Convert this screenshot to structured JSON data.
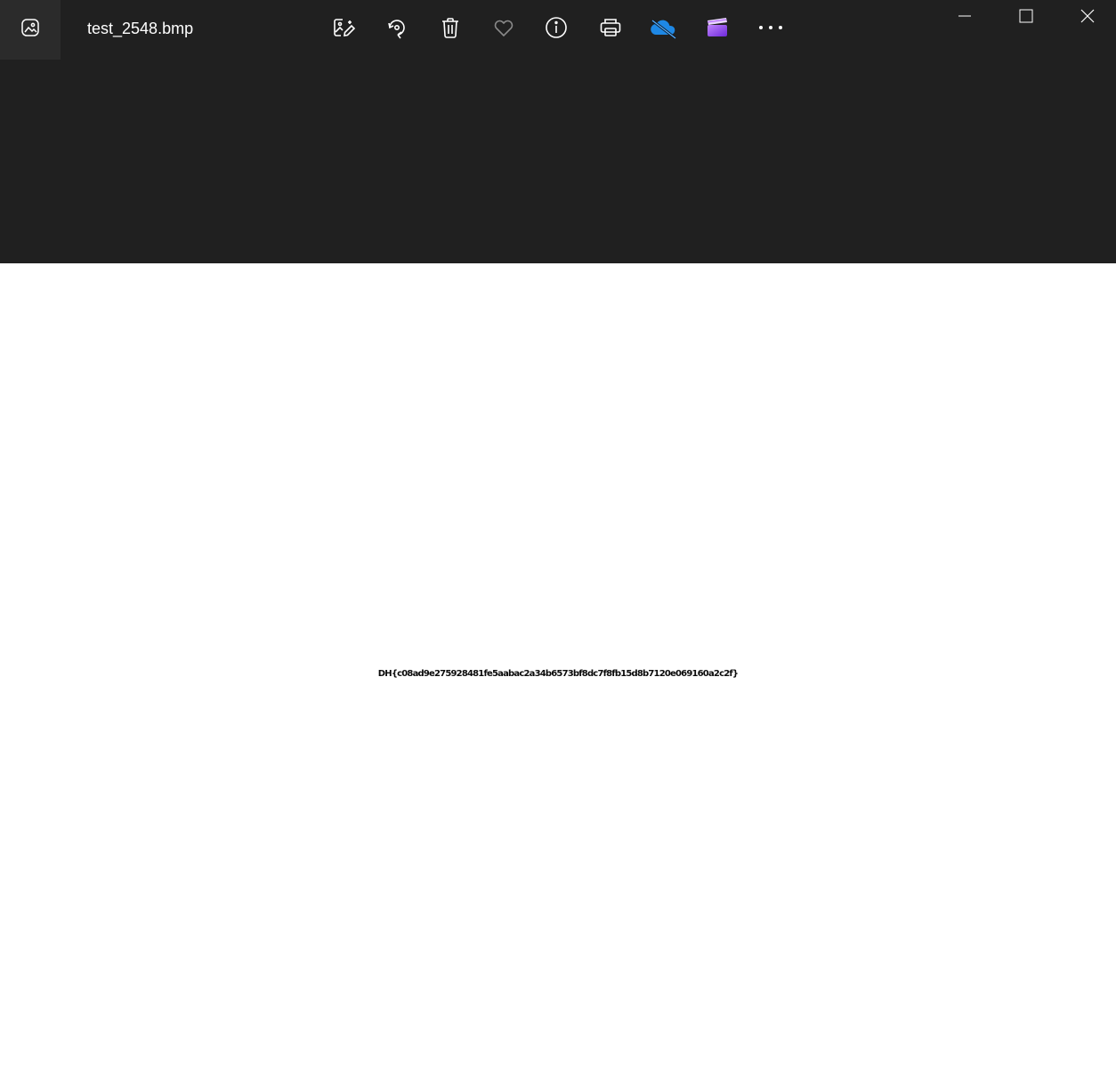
{
  "window": {
    "title": "test_2548.bmp"
  },
  "toolbar": {
    "items": [
      {
        "name": "edit-image",
        "icon": "edit-image-icon"
      },
      {
        "name": "rotate",
        "icon": "rotate-icon"
      },
      {
        "name": "delete",
        "icon": "trash-icon"
      },
      {
        "name": "favorite",
        "icon": "heart-icon"
      },
      {
        "name": "info",
        "icon": "info-icon"
      },
      {
        "name": "print",
        "icon": "printer-icon"
      },
      {
        "name": "onedrive",
        "icon": "onedrive-cloud-off-icon"
      },
      {
        "name": "video-editor",
        "icon": "clapperboard-icon"
      },
      {
        "name": "more",
        "icon": "more-dots-icon"
      }
    ]
  },
  "window_controls": [
    "minimize-icon",
    "maximize-icon",
    "close-icon"
  ],
  "image": {
    "text": "DH{c08ad9e275928481fe5aabac2a34b6573bf8dc7f8fb15d8b7120e069160a2c2f}"
  },
  "colors": {
    "titlebar_bg": "#202020",
    "app_icon_bg": "#2b2b2b",
    "image_bg": "#ffffff",
    "onedrive_blue": "#1e88e5",
    "clapper_purple": "#8b5cf6"
  }
}
